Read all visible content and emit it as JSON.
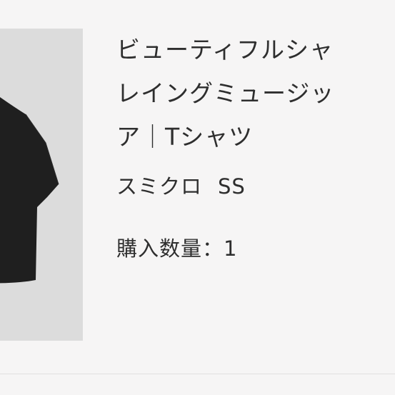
{
  "product": {
    "image_icon": "black-tshirt-thumbnail",
    "title_lines": [
      "ビューティフルシャ",
      "レイングミュージッ",
      "ア｜Tシャツ"
    ],
    "color": "スミクロ",
    "size": "SS",
    "quantity_label": "購入数量：",
    "quantity": "1"
  },
  "colors": {
    "background": "#f6f5f5",
    "thumbnail_bg": "#dcdcdc",
    "shirt": "#1f1f1f",
    "text": "#2e2e2e"
  }
}
